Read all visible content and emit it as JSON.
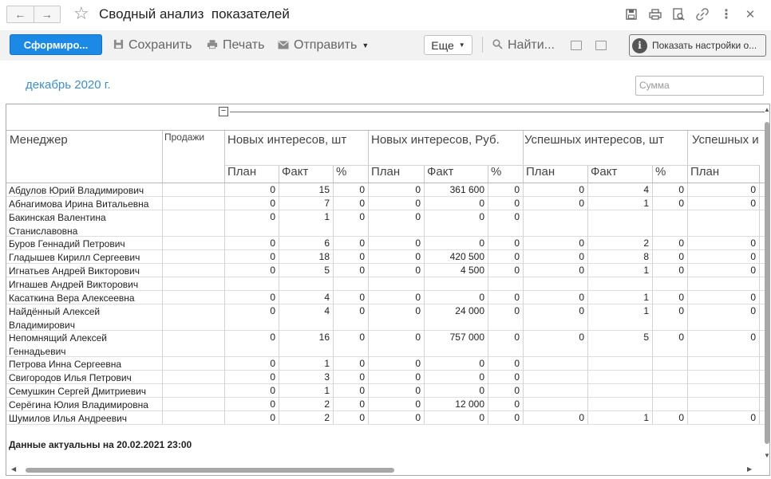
{
  "window": {
    "title": "Сводный анализ  показателей",
    "nav_back": "←",
    "nav_forward": "→"
  },
  "toolbar": {
    "generate": "Сформиро...",
    "save": "Сохранить",
    "print": "Печать",
    "send": "Отправить",
    "more": "Еще",
    "find": "Найти...",
    "show_settings": "Показать настройки о..."
  },
  "filters": {
    "period": "декабрь 2020 г.",
    "sum_placeholder": "Сумма"
  },
  "report": {
    "head": {
      "manager": "Менеджер",
      "sales": "Продажи",
      "groups": [
        "Новых интересов, шт",
        "Новых интересов, Руб.",
        "Успешных интересов, шт",
        "Успешных и"
      ],
      "sub": [
        "План",
        "Факт",
        "%",
        "План",
        "Факт",
        "%",
        "План",
        "Факт",
        "%",
        "План"
      ]
    },
    "rows": [
      {
        "name": "Абдулов Юрий Владимирович",
        "v": [
          "0",
          "15",
          "0",
          "0",
          "361 600",
          "0",
          "0",
          "4",
          "0",
          "0"
        ]
      },
      {
        "name": "Абнагимова Ирина Витальевна",
        "v": [
          "0",
          "7",
          "0",
          "0",
          "0",
          "0",
          "0",
          "1",
          "0",
          "0"
        ]
      },
      {
        "name": "Бакинская Валентина Станиславовна",
        "v": [
          "0",
          "1",
          "0",
          "0",
          "0",
          "0",
          "",
          "",
          "",
          ""
        ]
      },
      {
        "name": "Буров Геннадий Петрович",
        "v": [
          "0",
          "6",
          "0",
          "0",
          "0",
          "0",
          "0",
          "2",
          "0",
          "0"
        ]
      },
      {
        "name": "Гладышев Кирилл Сергеевич",
        "v": [
          "0",
          "18",
          "0",
          "0",
          "420 500",
          "0",
          "0",
          "8",
          "0",
          "0"
        ]
      },
      {
        "name": "Игнатьев Андрей Викторович",
        "v": [
          "0",
          "5",
          "0",
          "0",
          "4 500",
          "0",
          "0",
          "1",
          "0",
          "0"
        ]
      },
      {
        "name": "Игнашев Андрей Викторович",
        "v": [
          "",
          "",
          "",
          "",
          "",
          "",
          "",
          "",
          "",
          ""
        ]
      },
      {
        "name": "Касаткина Вера Алексеевна",
        "v": [
          "0",
          "4",
          "0",
          "0",
          "0",
          "0",
          "0",
          "1",
          "0",
          "0"
        ]
      },
      {
        "name": "Найдённый Алексей Владимирович",
        "v": [
          "0",
          "4",
          "0",
          "0",
          "24 000",
          "0",
          "0",
          "1",
          "0",
          "0"
        ]
      },
      {
        "name": "Непомнящий Алексей Геннадьевич",
        "v": [
          "0",
          "16",
          "0",
          "0",
          "757 000",
          "0",
          "0",
          "5",
          "0",
          "0"
        ]
      },
      {
        "name": "Петрова Инна Сергеевна",
        "v": [
          "0",
          "1",
          "0",
          "0",
          "0",
          "0",
          "",
          "",
          "",
          ""
        ]
      },
      {
        "name": "Свигородов Илья Петрович",
        "v": [
          "0",
          "3",
          "0",
          "0",
          "0",
          "0",
          "",
          "",
          "",
          ""
        ]
      },
      {
        "name": "Семушкин Сергей Дмитриевич",
        "v": [
          "0",
          "1",
          "0",
          "0",
          "0",
          "0",
          "",
          "",
          "",
          ""
        ]
      },
      {
        "name": "Серёгина Юлия Владимировна",
        "v": [
          "0",
          "2",
          "0",
          "0",
          "12 000",
          "0",
          "",
          "",
          "",
          ""
        ]
      },
      {
        "name": "Шумилов Илья Андреевич",
        "v": [
          "0",
          "2",
          "0",
          "0",
          "0",
          "0",
          "0",
          "1",
          "0",
          "0"
        ]
      }
    ],
    "footer": "Данные актуальны на 20.02.2021 23:00"
  }
}
